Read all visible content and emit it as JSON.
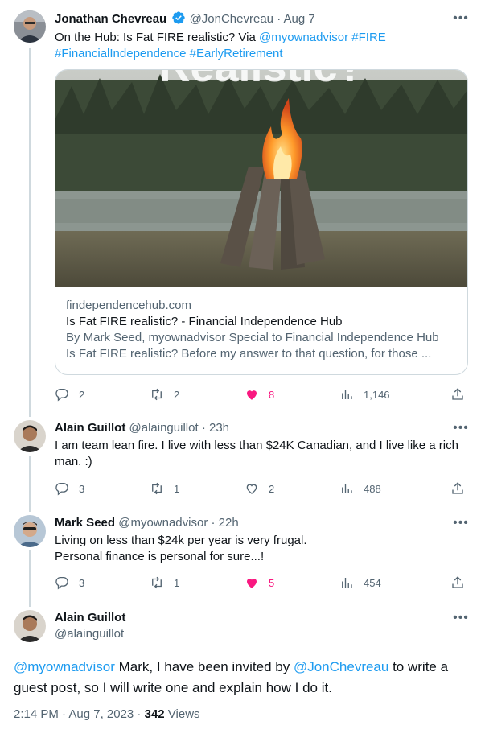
{
  "tweets": [
    {
      "name": "Jonathan Chevreau",
      "handle": "@JonChevreau",
      "time": "· Aug 7",
      "text_prefix": "On the Hub: Is Fat FIRE realistic? Via ",
      "mention": "@myownadvisor",
      "hashtag1": "#FIRE",
      "hashtag2": "#FinancialIndependence",
      "hashtag3": "#EarlyRetirement",
      "card": {
        "image_text": "Realistic?",
        "domain": "findependencehub.com",
        "title": "Is Fat FIRE realistic? - Financial Independence Hub",
        "line1": "By Mark Seed, myownadvisor Special to Financial Independence Hub",
        "line2": "Is Fat FIRE realistic? Before my answer to that question, for those ..."
      },
      "replies": "2",
      "retweets": "2",
      "likes": "8",
      "views": "1,146"
    },
    {
      "name": "Alain Guillot",
      "handle": "@alainguillot",
      "time": "· 23h",
      "line1": "I am team lean fire. I live with less than $24K Canadian, and I live like a rich",
      "line2": "man. :)",
      "replies": "3",
      "retweets": "1",
      "likes": "2",
      "views": "488"
    },
    {
      "name": "Mark Seed",
      "handle": "@myownadvisor",
      "time": "· 22h",
      "line1": "Living on less than $24k per year is very frugal.",
      "line2": "Personal finance is personal for sure...!",
      "replies": "3",
      "retweets": "1",
      "likes": "5",
      "views": "454"
    }
  ],
  "focused": {
    "name": "Alain Guillot",
    "handle": "@alainguillot",
    "mention1": "@myownadvisor",
    "text1": " Mark, I have been invited by ",
    "mention2": "@JonChevreau",
    "text2": " to write a",
    "line2": "guest post, so I will write one and explain how I do it.",
    "timestamp": "2:14 PM · Aug 7, 2023 · ",
    "views_count": "342",
    "views_label": " Views"
  },
  "colors": {
    "accent": "#1d9bf0",
    "like": "#f91880",
    "muted": "#536471",
    "border": "#cfd9de"
  },
  "icons": [
    "verified-badge-icon",
    "more-icon",
    "reply-icon",
    "retweet-icon",
    "like-icon",
    "views-icon",
    "share-icon"
  ]
}
